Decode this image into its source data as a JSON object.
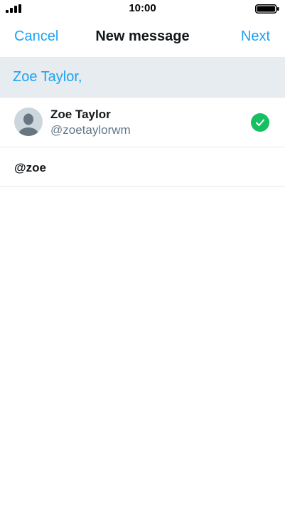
{
  "status_bar": {
    "time": "10:00",
    "signal_icon": "signal-bars-icon",
    "battery_icon": "battery-icon"
  },
  "nav": {
    "cancel_label": "Cancel",
    "title": "New message",
    "next_label": "Next"
  },
  "recipients": {
    "selected": "Zoe Taylor,"
  },
  "results": [
    {
      "name": "Zoe Taylor",
      "handle": "@zoetaylorwm",
      "selected": true,
      "avatar_icon": "default-avatar-icon",
      "check_icon": "checkmark-circle-icon"
    }
  ],
  "query": {
    "text": "@zoe"
  },
  "colors": {
    "accent": "#1da1f2",
    "selected_check": "#17bf63",
    "recipient_bar_bg": "#e6ecf0",
    "secondary_text": "#657786"
  }
}
